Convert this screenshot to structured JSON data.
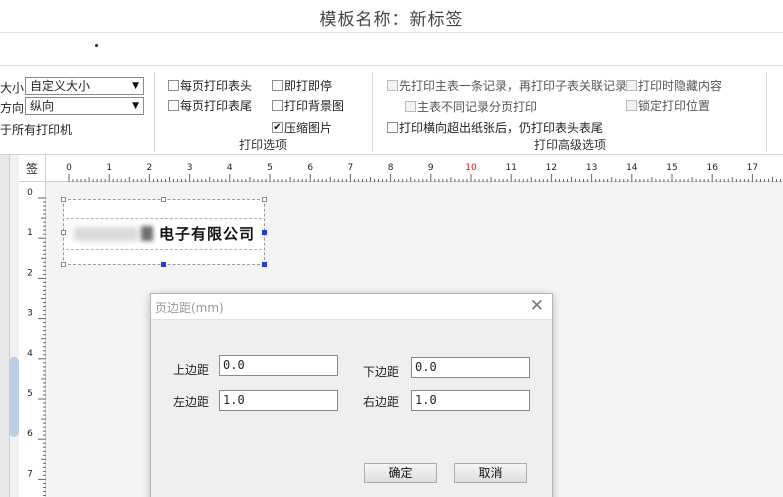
{
  "window": {
    "title": "模板名称：新标签"
  },
  "page_options": {
    "size_label": "大小",
    "size_value": "自定义大小",
    "orientation_label": "方向",
    "orientation_value": "纵向",
    "printers_label": "于所有打印机"
  },
  "print_options": {
    "title": "打印选项",
    "items": [
      {
        "label": "每页打印表头",
        "checked": false
      },
      {
        "label": "每页打印表尾",
        "checked": false
      },
      {
        "label": "即打即停",
        "checked": false
      },
      {
        "label": "打印背景图",
        "checked": false
      },
      {
        "label": "压缩图片",
        "checked": true
      }
    ]
  },
  "advanced_options": {
    "title": "打印高级选项",
    "items": [
      {
        "label": "先打印主表一条记录，再打印子表关联记录",
        "checked": false,
        "disabled": true
      },
      {
        "label": "主表不同记录分页打印",
        "checked": false,
        "disabled": true
      },
      {
        "label": "打印横向超出纸张后，仍打印表头表尾",
        "checked": false,
        "disabled": false
      },
      {
        "label": "打印时隐藏内容",
        "checked": false,
        "disabled": true
      },
      {
        "label": "锁定打印位置",
        "checked": false,
        "disabled": true
      }
    ]
  },
  "rulers": {
    "corner": "签",
    "h_labels": [
      "0",
      "1",
      "2",
      "3",
      "4",
      "5",
      "6",
      "7",
      "8",
      "9",
      "10",
      "11",
      "12",
      "13",
      "14",
      "15",
      "16",
      "17"
    ],
    "v_labels": [
      "0",
      "1",
      "2",
      "3",
      "4",
      "5",
      "6",
      "7"
    ]
  },
  "label_element": {
    "text": "电子有限公司"
  },
  "dialog": {
    "title": "页边距(mm)",
    "top_label": "上边距",
    "top_value": "0.0",
    "bottom_label": "下边距",
    "bottom_value": "0.0",
    "left_label": "左边距",
    "left_value": "1.0",
    "right_label": "右边距",
    "right_value": "1.0",
    "ok_label": "确定",
    "cancel_label": "取消"
  },
  "colors": {
    "ruler_red": "#d11a1a",
    "handle_blue": "#1f3cd8"
  }
}
